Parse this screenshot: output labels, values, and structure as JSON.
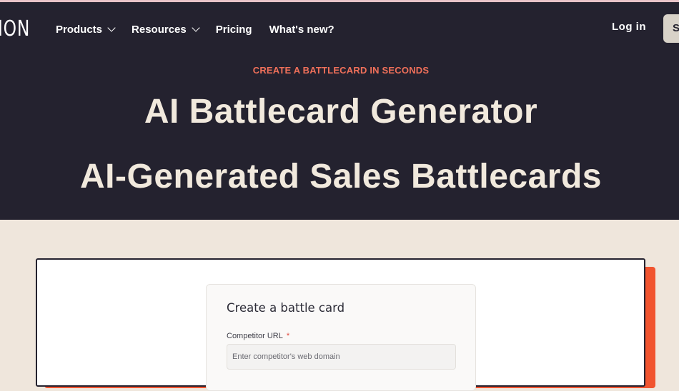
{
  "brand": {
    "logo_text": "ION"
  },
  "nav": {
    "items": [
      {
        "label": "Products",
        "has_dropdown": true
      },
      {
        "label": "Resources",
        "has_dropdown": true
      },
      {
        "label": "Pricing",
        "has_dropdown": false
      },
      {
        "label": "What's new?",
        "has_dropdown": false
      }
    ],
    "login_label": "Log in",
    "cta_label": "S"
  },
  "hero": {
    "eyebrow": "CREATE A BATTLECARD IN SECONDS",
    "title": "AI Battlecard Generator",
    "subtitle": "AI-Generated Sales Battlecards"
  },
  "form": {
    "title": "Create a battle card",
    "competitor_url": {
      "label": "Competitor URL",
      "required_mark": "*",
      "value": "",
      "placeholder": "Enter competitor's web domain"
    }
  },
  "colors": {
    "hero_bg": "#24222f",
    "page_bg": "#efe6dc",
    "accent": "#f0705a",
    "shadow_accent": "#f1542f",
    "heading_text": "#f1e9dd"
  }
}
